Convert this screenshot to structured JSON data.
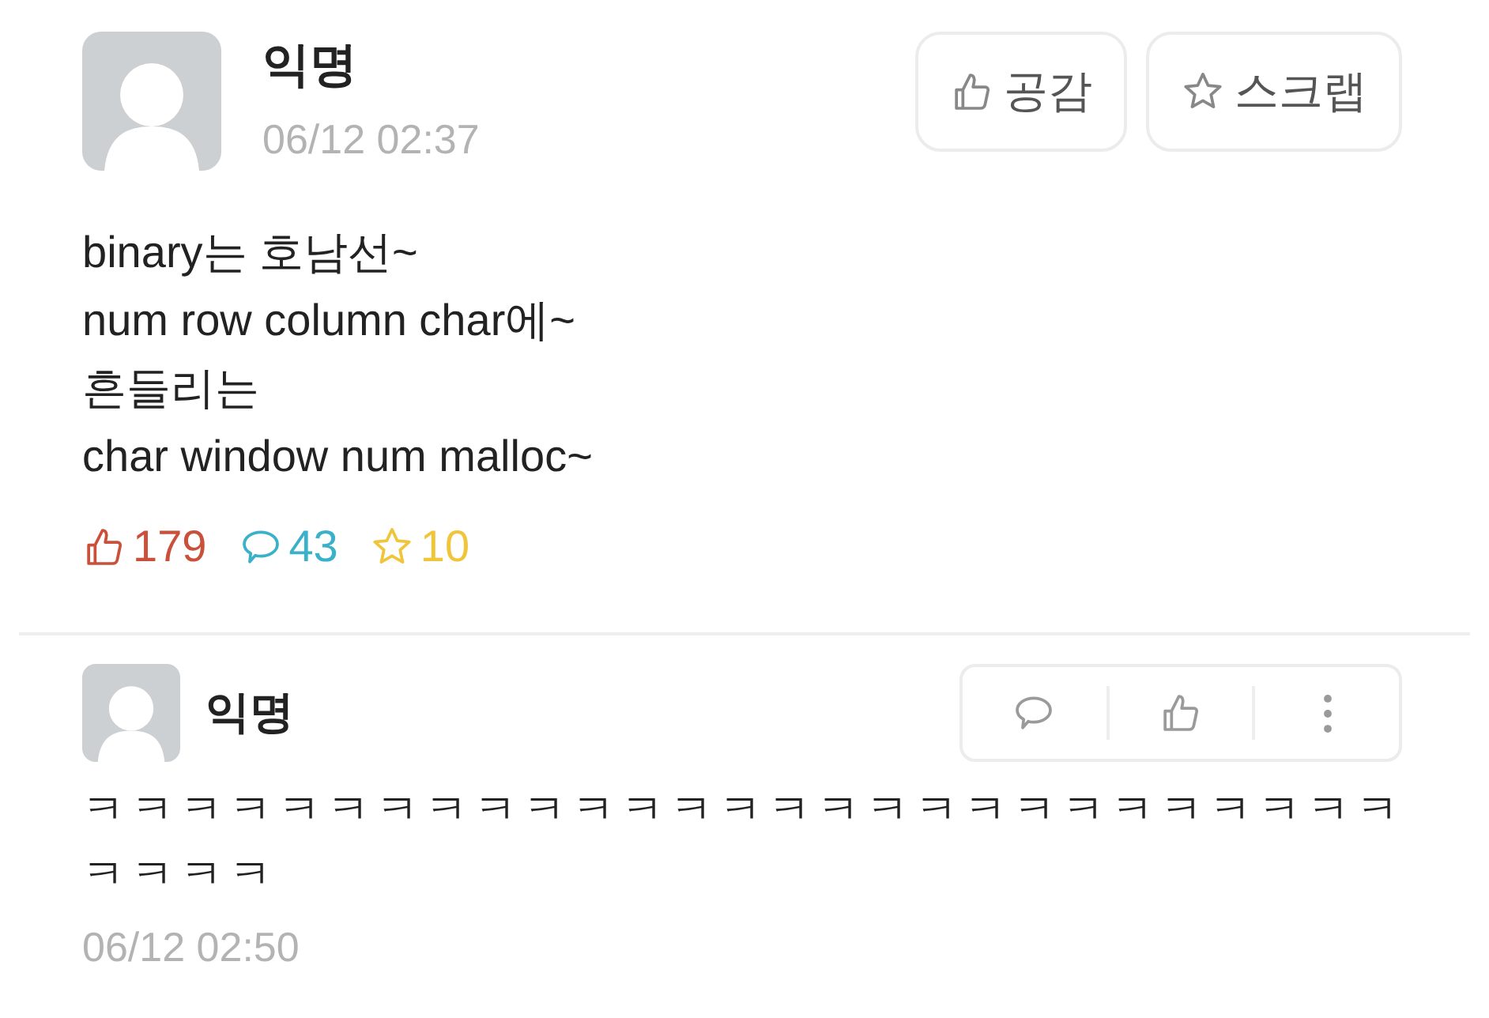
{
  "post": {
    "author": "익명",
    "time": "06/12 02:37",
    "buttons": [
      {
        "kind": "like",
        "label": "공감"
      },
      {
        "kind": "scrap",
        "label": "스크랩"
      }
    ],
    "lines": [
      "binary는 호남선~",
      "num row column char에~",
      "흔들리는",
      "char window num malloc~"
    ],
    "counts": [
      {
        "kind": "like",
        "value": "179",
        "color": "#c9513b"
      },
      {
        "kind": "comment",
        "value": "43",
        "color": "#3bb0c9"
      },
      {
        "kind": "scrap",
        "value": "10",
        "color": "#f0c53a"
      }
    ]
  },
  "comment": {
    "author": "익명",
    "text": "ㅋㅋㅋㅋㅋㅋㅋㅋㅋㅋㅋㅋㅋㅋㅋㅋㅋㅋㅋㅋㅋㅋㅋㅋㅋㅋㅋㅋㅋㅋㅋ",
    "time": "06/12 02:50",
    "actions": [
      {
        "kind": "comment"
      },
      {
        "kind": "like"
      },
      {
        "kind": "more"
      }
    ]
  }
}
